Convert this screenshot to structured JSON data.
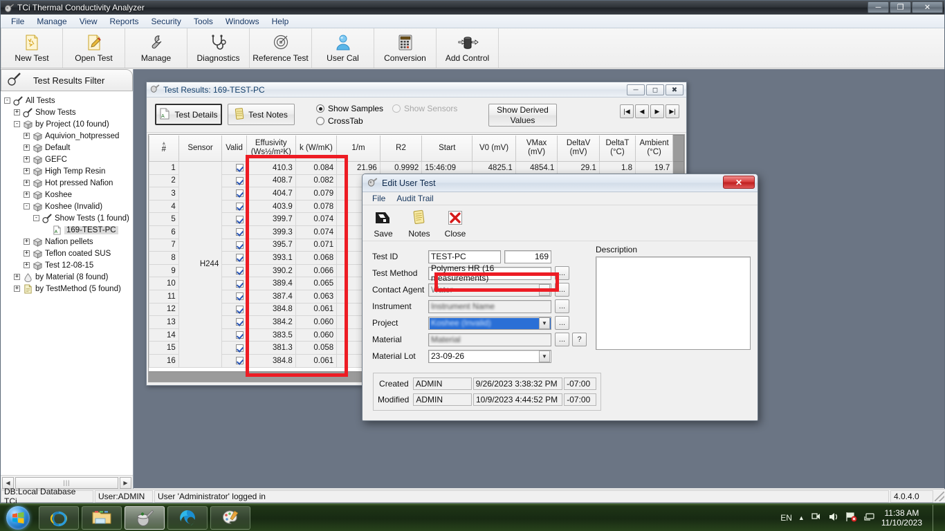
{
  "window": {
    "title": "TCi Thermal Conductivity Analyzer",
    "minimize": "—",
    "maximize": "❐",
    "close": "✕"
  },
  "menubar": {
    "items": [
      "File",
      "Manage",
      "View",
      "Reports",
      "Security",
      "Tools",
      "Windows",
      "Help"
    ]
  },
  "toolbar": {
    "buttons": [
      {
        "label": "New Test",
        "icon": "new-test-icon"
      },
      {
        "label": "Open Test",
        "icon": "open-test-icon"
      },
      {
        "label": "Manage",
        "icon": "wrench-icon"
      },
      {
        "label": "Diagnostics",
        "icon": "stethoscope-icon"
      },
      {
        "label": "Reference Test",
        "icon": "target-icon"
      },
      {
        "label": "User Cal",
        "icon": "user-icon"
      },
      {
        "label": "Conversion",
        "icon": "calculator-icon"
      },
      {
        "label": "Add Control",
        "icon": "add-control-icon"
      }
    ]
  },
  "sidebar": {
    "header": "Test Results Filter",
    "tree": [
      {
        "label": "All Tests",
        "depth": 0,
        "exp": "-",
        "icon": "magnifier-icon"
      },
      {
        "label": "Show Tests",
        "depth": 1,
        "exp": "+",
        "icon": "magnifier-icon"
      },
      {
        "label": "by Project (10 found)",
        "depth": 1,
        "exp": "-",
        "icon": "box-icon"
      },
      {
        "label": "Aquivion_hotpressed",
        "depth": 2,
        "exp": "+",
        "icon": "box-icon"
      },
      {
        "label": "Default",
        "depth": 2,
        "exp": "+",
        "icon": "box-icon"
      },
      {
        "label": "GEFC",
        "depth": 2,
        "exp": "+",
        "icon": "box-icon"
      },
      {
        "label": "High Temp Resin",
        "depth": 2,
        "exp": "+",
        "icon": "box-icon"
      },
      {
        "label": "Hot pressed Nafion",
        "depth": 2,
        "exp": "+",
        "icon": "box-icon"
      },
      {
        "label": "Koshee",
        "depth": 2,
        "exp": "+",
        "icon": "box-icon"
      },
      {
        "label": "Koshee (Invalid)",
        "depth": 2,
        "exp": "-",
        "icon": "box-icon"
      },
      {
        "label": "Show Tests (1 found)",
        "depth": 3,
        "exp": "-",
        "icon": "magnifier-icon"
      },
      {
        "label": "169-TEST-PC",
        "depth": 4,
        "exp": "",
        "icon": "test-doc-icon",
        "selected": true
      },
      {
        "label": "Nafion pellets",
        "depth": 2,
        "exp": "+",
        "icon": "box-icon"
      },
      {
        "label": "Teflon coated SUS",
        "depth": 2,
        "exp": "+",
        "icon": "box-icon"
      },
      {
        "label": "Test 12-08-15",
        "depth": 2,
        "exp": "+",
        "icon": "box-icon"
      },
      {
        "label": "by Material (8 found)",
        "depth": 1,
        "exp": "+",
        "icon": "material-icon"
      },
      {
        "label": "by TestMethod (5 found)",
        "depth": 1,
        "exp": "+",
        "icon": "doc-icon"
      }
    ]
  },
  "test_results_window": {
    "title": "Test Results: 169-TEST-PC",
    "controls": {
      "minimize": "—",
      "restore": "❐",
      "close": "✕"
    },
    "buttons": {
      "test_details": "Test Details",
      "test_notes": "Test Notes",
      "show_derived": "Show Derived Values"
    },
    "radios": [
      {
        "label": "Show Samples",
        "checked": true,
        "disabled": false
      },
      {
        "label": "Show Sensors",
        "checked": false,
        "disabled": true
      },
      {
        "label": "CrossTab",
        "checked": false,
        "disabled": false
      }
    ],
    "nav": [
      "|◀",
      "◀",
      "▶",
      "▶|"
    ],
    "columns": [
      "#",
      "Sensor",
      "Valid",
      "Effusivity\n(Ws½/m²K)",
      "k (W/mK)",
      "1/m",
      "R2",
      "Start",
      "V0 (mV)",
      "VMax\n(mV)",
      "DeltaV\n(mV)",
      "DeltaT\n(°C)",
      "Ambient\n(°C)"
    ],
    "sensor": "H244",
    "rows": [
      {
        "n": "1",
        "valid": true,
        "effusivity": "410.3",
        "k": "0.084",
        "invm": "21.96",
        "r2": "0.9992",
        "start": "15:46:09",
        "v0": "4825.1",
        "vmax": "4854.1",
        "deltav": "29.1",
        "deltat": "1.8",
        "ambient": "19.7"
      },
      {
        "n": "2",
        "valid": true,
        "effusivity": "408.7",
        "k": "0.082",
        "invm": "",
        "r2": "",
        "start": "",
        "v0": "",
        "vmax": "",
        "deltav": "",
        "deltat": "",
        "ambient": ""
      },
      {
        "n": "3",
        "valid": true,
        "effusivity": "404.7",
        "k": "0.079",
        "invm": "",
        "r2": "",
        "start": "",
        "v0": "",
        "vmax": "",
        "deltav": "",
        "deltat": "",
        "ambient": ""
      },
      {
        "n": "4",
        "valid": true,
        "effusivity": "403.9",
        "k": "0.078",
        "invm": "",
        "r2": "",
        "start": "",
        "v0": "",
        "vmax": "",
        "deltav": "",
        "deltat": "",
        "ambient": ""
      },
      {
        "n": "5",
        "valid": true,
        "effusivity": "399.7",
        "k": "0.074",
        "invm": "",
        "r2": "",
        "start": "",
        "v0": "",
        "vmax": "",
        "deltav": "",
        "deltat": "",
        "ambient": ""
      },
      {
        "n": "6",
        "valid": true,
        "effusivity": "399.3",
        "k": "0.074",
        "invm": "",
        "r2": "",
        "start": "",
        "v0": "",
        "vmax": "",
        "deltav": "",
        "deltat": "",
        "ambient": ""
      },
      {
        "n": "7",
        "valid": true,
        "effusivity": "395.7",
        "k": "0.071",
        "invm": "",
        "r2": "",
        "start": "",
        "v0": "",
        "vmax": "",
        "deltav": "",
        "deltat": "",
        "ambient": ""
      },
      {
        "n": "8",
        "valid": true,
        "effusivity": "393.1",
        "k": "0.068",
        "invm": "",
        "r2": "",
        "start": "",
        "v0": "",
        "vmax": "",
        "deltav": "",
        "deltat": "",
        "ambient": ""
      },
      {
        "n": "9",
        "valid": true,
        "effusivity": "390.2",
        "k": "0.066",
        "invm": "",
        "r2": "",
        "start": "",
        "v0": "",
        "vmax": "",
        "deltav": "",
        "deltat": "",
        "ambient": ""
      },
      {
        "n": "10",
        "valid": true,
        "effusivity": "389.4",
        "k": "0.065",
        "invm": "",
        "r2": "",
        "start": "",
        "v0": "",
        "vmax": "",
        "deltav": "",
        "deltat": "",
        "ambient": ""
      },
      {
        "n": "11",
        "valid": true,
        "effusivity": "387.4",
        "k": "0.063",
        "invm": "",
        "r2": "",
        "start": "",
        "v0": "",
        "vmax": "",
        "deltav": "",
        "deltat": "",
        "ambient": ""
      },
      {
        "n": "12",
        "valid": true,
        "effusivity": "384.8",
        "k": "0.061",
        "invm": "",
        "r2": "",
        "start": "",
        "v0": "",
        "vmax": "",
        "deltav": "",
        "deltat": "",
        "ambient": ""
      },
      {
        "n": "13",
        "valid": true,
        "effusivity": "384.2",
        "k": "0.060",
        "invm": "",
        "r2": "",
        "start": "",
        "v0": "",
        "vmax": "",
        "deltav": "",
        "deltat": "",
        "ambient": ""
      },
      {
        "n": "14",
        "valid": true,
        "effusivity": "383.5",
        "k": "0.060",
        "invm": "",
        "r2": "",
        "start": "",
        "v0": "",
        "vmax": "",
        "deltav": "",
        "deltat": "",
        "ambient": ""
      },
      {
        "n": "15",
        "valid": true,
        "effusivity": "381.3",
        "k": "0.058",
        "invm": "",
        "r2": "",
        "start": "",
        "v0": "",
        "vmax": "",
        "deltav": "",
        "deltat": "",
        "ambient": ""
      },
      {
        "n": "16",
        "valid": true,
        "effusivity": "384.8",
        "k": "0.061",
        "invm": "",
        "r2": "",
        "start": "",
        "v0": "",
        "vmax": "",
        "deltav": "",
        "deltat": "",
        "ambient": ""
      }
    ]
  },
  "dialog": {
    "title": "Edit User Test",
    "close": "✕",
    "menu": [
      "File",
      "Audit Trail"
    ],
    "toolbar": [
      {
        "label": "Save",
        "icon": "save-icon"
      },
      {
        "label": "Notes",
        "icon": "notes-icon"
      },
      {
        "label": "Close",
        "icon": "close-x-icon"
      }
    ],
    "fields": {
      "test_id_label": "Test ID",
      "test_id_value": "TEST-PC",
      "test_number_value": "169",
      "test_method_label": "Test Method",
      "test_method_value": "Polymers HR (16 measurements)",
      "contact_agent_label": "Contact Agent",
      "contact_agent_value": "Water",
      "instrument_label": "Instrument",
      "instrument_value": "Instrument Name",
      "project_label": "Project",
      "project_value": "Koshee (Invalid)",
      "material_label": "Material",
      "material_value": "Material",
      "material_lot_label": "Material Lot",
      "material_lot_value": "23-09-26",
      "ellipsis": "...",
      "help": "?"
    },
    "description_label": "Description",
    "description_value": "",
    "audit": {
      "created_label": "Created",
      "created_user": "ADMIN",
      "created_time": "9/26/2023 3:38:32 PM",
      "created_tz": "-07:00",
      "modified_label": "Modified",
      "modified_user": "ADMIN",
      "modified_time": "10/9/2023 4:44:52 PM",
      "modified_tz": "-07:00"
    }
  },
  "statusbar": {
    "db": "DB:Local Database TCi",
    "user": "User:ADMIN",
    "message": "User 'Administrator' logged in",
    "version": "4.0.4.0"
  },
  "taskbar": {
    "items": [
      {
        "name": "internet-explorer",
        "active": false
      },
      {
        "name": "file-explorer",
        "active": false
      },
      {
        "name": "tci-analyzer",
        "active": true
      },
      {
        "name": "microsoft-edge",
        "active": false
      },
      {
        "name": "paint",
        "active": false
      }
    ],
    "tray": {
      "lang": "EN",
      "time": "11:38 AM",
      "date": "11/10/2023"
    }
  },
  "annotations": {
    "highlight_color": "#ED1C24",
    "cell_highlight_color": "#FFA500"
  }
}
